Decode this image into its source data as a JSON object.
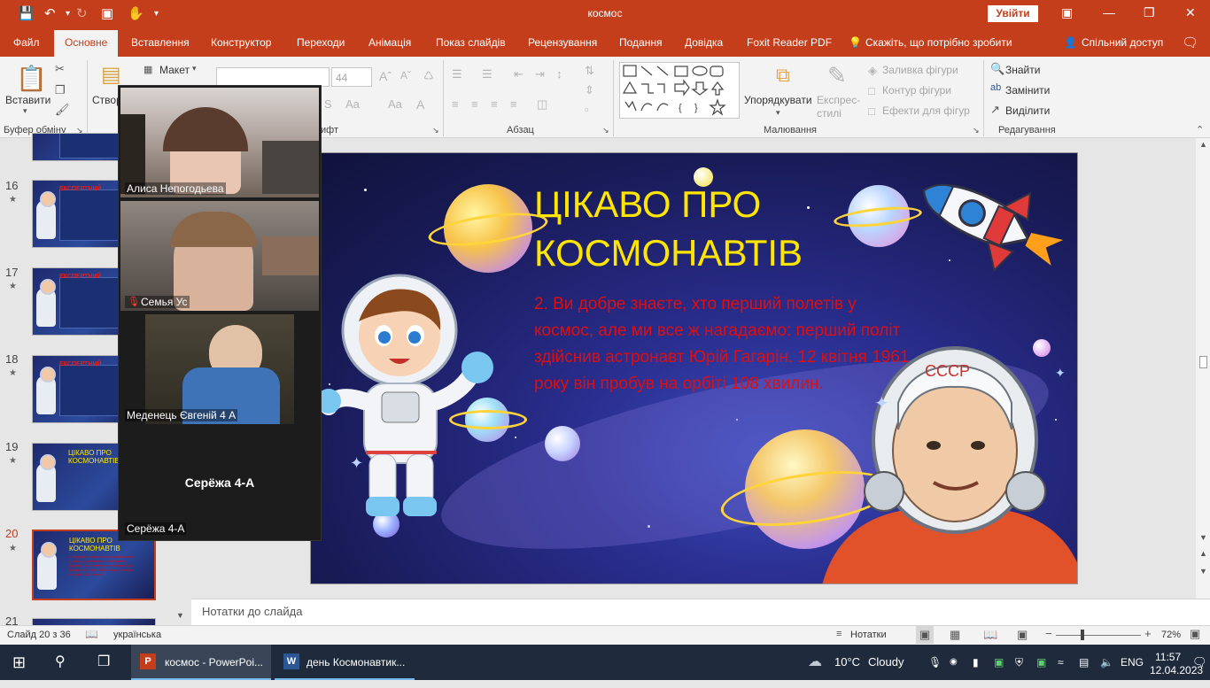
{
  "window": {
    "title": "космос",
    "signin_label": "Увійти"
  },
  "tabs": [
    "Файл",
    "Основне",
    "Вставлення",
    "Конструктор",
    "Переходи",
    "Анімація",
    "Показ слайдів",
    "Рецензування",
    "Подання",
    "Довідка",
    "Foxit Reader PDF"
  ],
  "tell_me": "Скажіть, що потрібно зробити",
  "share_label": "Спільний доступ",
  "ribbon": {
    "paste_label": "Вставити",
    "new_slide_label": "Створ слай",
    "layout_label": "Макет",
    "font_size": "44",
    "clipboard_group": "Буфер обміну",
    "font_group": "ифт",
    "paragraph_group": "Абзац",
    "drawing_group": "Малювання",
    "editing_group": "Редагування",
    "arrange_label": "Упорядкувати",
    "quick_styles_label": "Експрес-стилі",
    "shape_fill": "Заливка фігури",
    "shape_outline": "Контур фігури",
    "shape_effects": "Ефекти для фігур",
    "find_label": "Знайти",
    "replace_label": "Замінити",
    "select_label": "Виділити"
  },
  "thumbnails": [
    {
      "num": "16",
      "label": "ЕКСПЕРТНИЙ"
    },
    {
      "num": "17",
      "label": "ЕКСПЕРТНИЙ"
    },
    {
      "num": "18",
      "label": "ЕКСПЕРТНИЙ"
    },
    {
      "num": "19",
      "label": "ЦІКАВО ПРО КОСМОНАВТІВ"
    },
    {
      "num": "20",
      "label": "ЦІКАВО ПРО КОСМОНАВТІВ"
    },
    {
      "num": "21",
      "label": ""
    }
  ],
  "slide": {
    "title": "ЦІКАВО ПРО КОСМОНАВТІВ",
    "body": "2. Ви добре знаєте, хто перший полетів у космос, але ми все ж нагадаємо: перший політ здійснив астронавт Юрій Гагарін. 12 квітня 1961 року він пробув на орбіті 108 хвилин."
  },
  "notes_placeholder": "Нотатки до слайда",
  "status": {
    "slide_count": "Слайд 20 з 36",
    "language": "українська",
    "notes_label": "Нотатки",
    "zoom": "72%"
  },
  "zoom_participants": [
    {
      "name": "Алиса Непогодьева"
    },
    {
      "name": "Семья Ус"
    },
    {
      "name": "Меденець Євгеній 4 А"
    },
    {
      "name": "Серёжа 4-А",
      "display": "Серёжа 4-А"
    }
  ],
  "taskbar": {
    "app1": "космос - PowerPoi...",
    "app2": "день Космонавтик...",
    "weather_temp": "10°C",
    "weather_desc": "Cloudy",
    "lang": "ENG",
    "time": "11:57",
    "date": "12.04.2023"
  },
  "colors": {
    "accent": "#c43e1c",
    "slide_title": "#ffe600",
    "slide_body": "#e00e0e"
  }
}
